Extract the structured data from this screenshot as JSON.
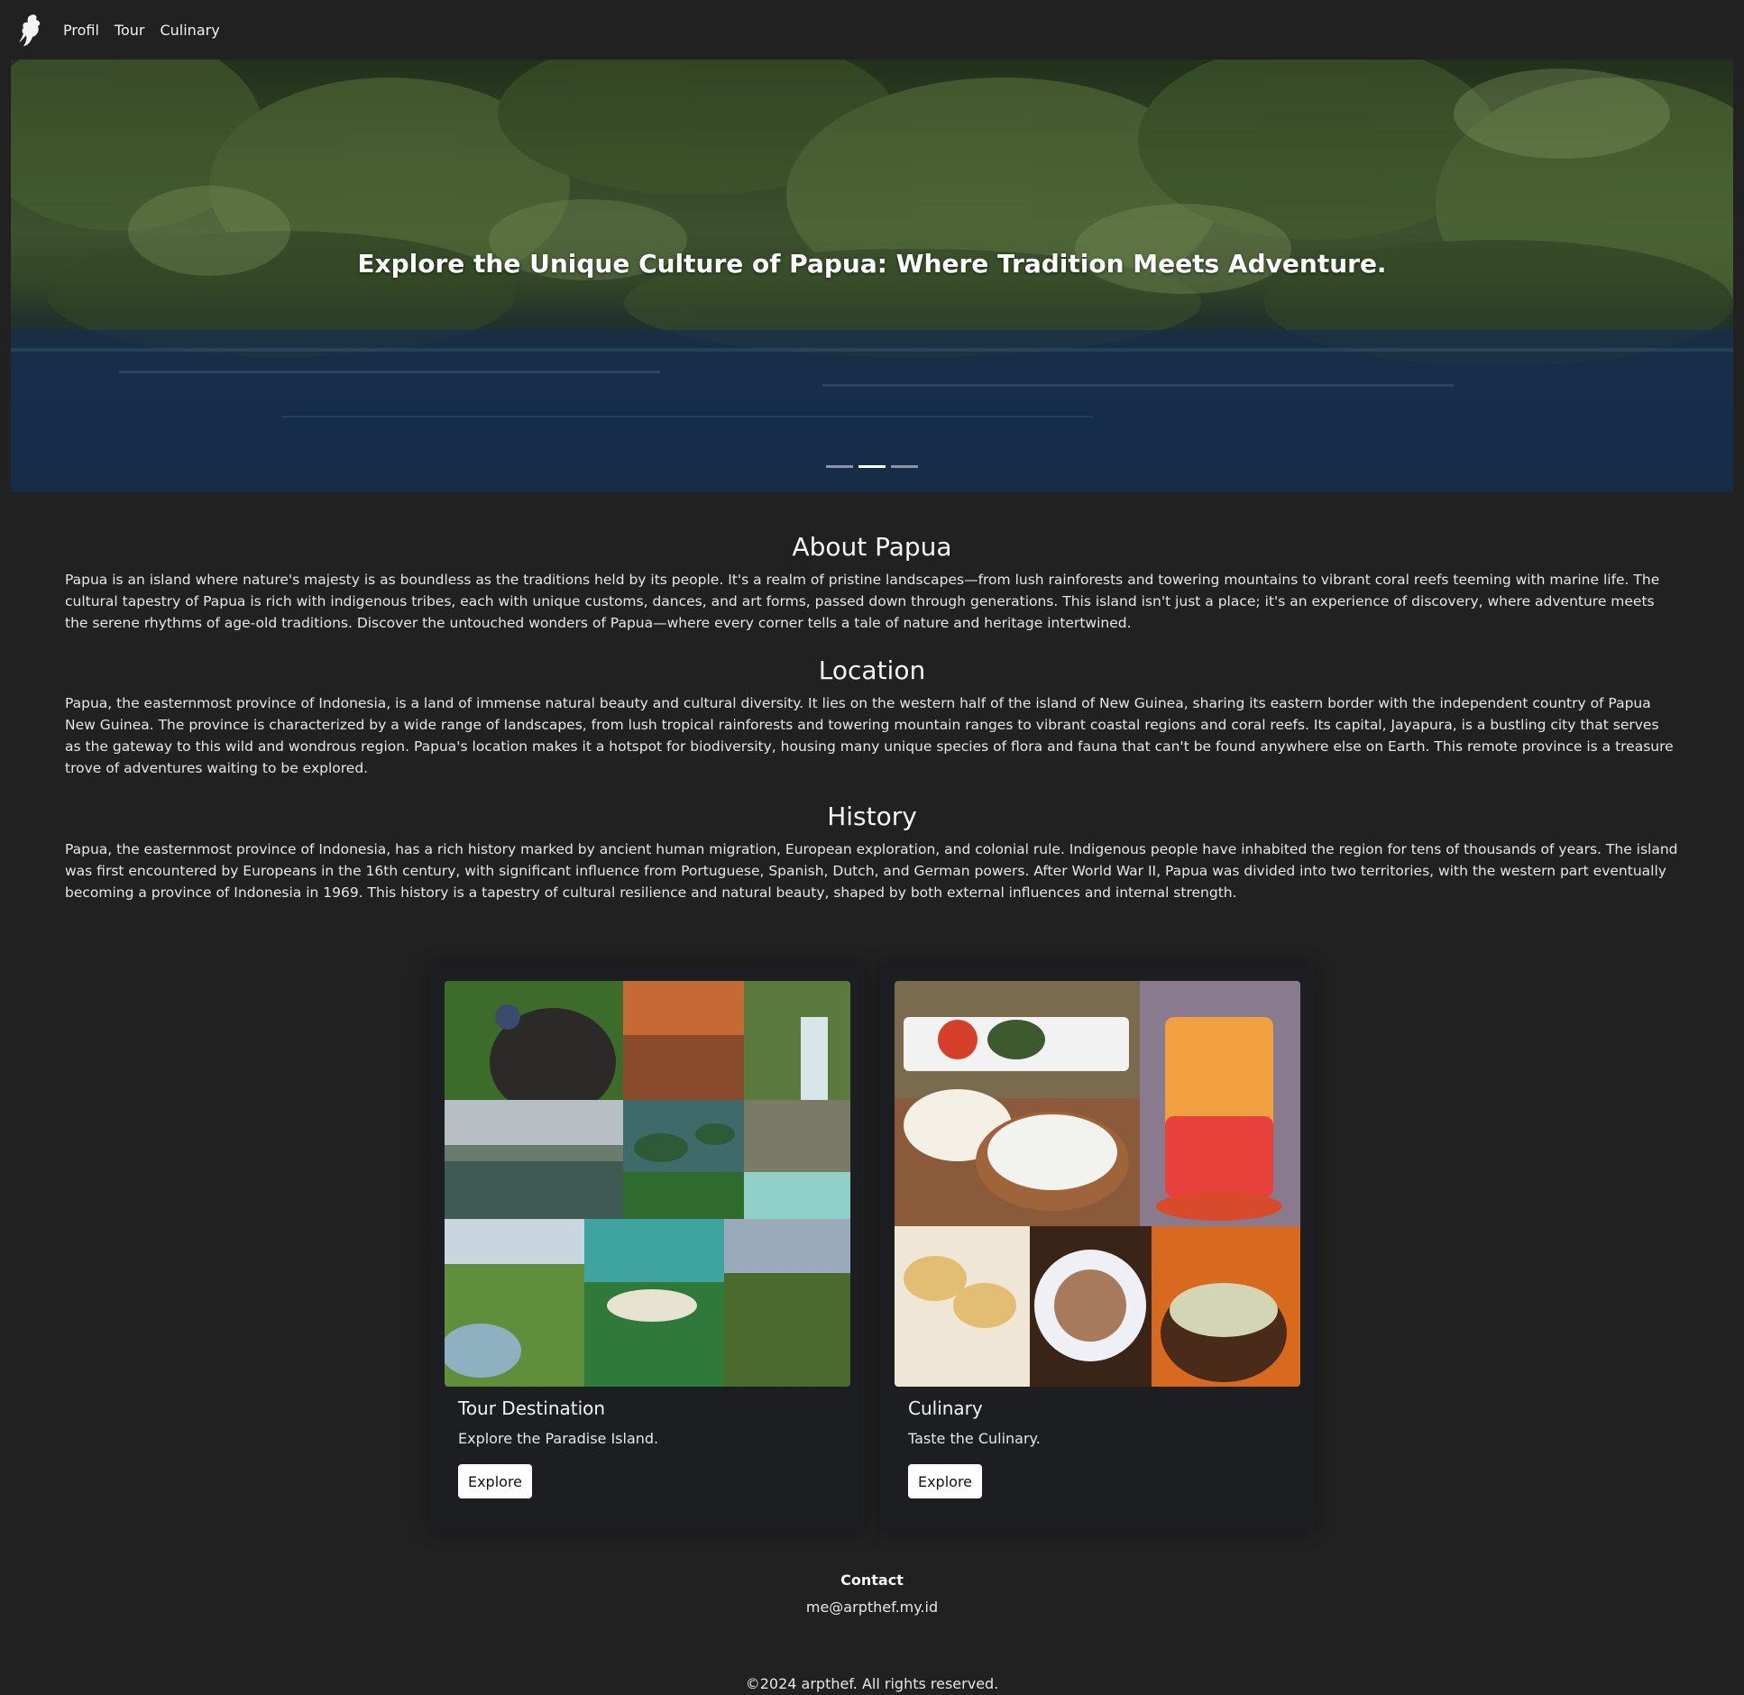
{
  "nav": {
    "logo_icon": "bird-of-paradise-logo-icon",
    "links": [
      "Profil",
      "Tour",
      "Culinary"
    ]
  },
  "hero": {
    "title": "Explore the Unique Culture of Papua: Where Tradition Meets Adventure.",
    "slide_count": 3,
    "active_slide": 2
  },
  "sections": {
    "about": {
      "heading": "About Papua",
      "body": "Papua is an island where nature's majesty is as boundless as the traditions held by its people. It's a realm of pristine landscapes—from lush rainforests and towering mountains to vibrant coral reefs teeming with marine life. The cultural tapestry of Papua is rich with indigenous tribes, each with unique customs, dances, and art forms, passed down through generations. This island isn't just a place; it's an experience of discovery, where adventure meets the serene rhythms of age-old traditions. Discover the untouched wonders of Papua—where every corner tells a tale of nature and heritage intertwined."
    },
    "location": {
      "heading": "Location",
      "body": "Papua, the easternmost province of Indonesia, is a land of immense natural beauty and cultural diversity. It lies on the western half of the island of New Guinea, sharing its eastern border with the independent country of Papua New Guinea. The province is characterized by a wide range of landscapes, from lush tropical rainforests and towering mountain ranges to vibrant coastal regions and coral reefs. Its capital, Jayapura, is a bustling city that serves as the gateway to this wild and wondrous region. Papua's location makes it a hotspot for biodiversity, housing many unique species of flora and fauna that can't be found anywhere else on Earth. This remote province is a treasure trove of adventures waiting to be explored."
    },
    "history": {
      "heading": "History",
      "body": "Papua, the easternmost province of Indonesia, has a rich history marked by ancient human migration, European exploration, and colonial rule. Indigenous people have inhabited the region for tens of thousands of years. The island was first encountered by Europeans in the 16th century, with significant influence from Portuguese, Spanish, Dutch, and German powers. After World War II, Papua was divided into two territories, with the western part eventually becoming a province of Indonesia in 1969. This history is a tapestry of cultural resilience and natural beauty, shaped by both external influences and internal strength."
    }
  },
  "cards": [
    {
      "title": "Tour Destination",
      "text": "Explore the Paradise Island.",
      "button": "Explore"
    },
    {
      "title": "Culinary",
      "text": "Taste the Culinary.",
      "button": "Explore"
    }
  ],
  "footer": {
    "contact_title": "Contact",
    "email": "me@arpthef.my.id",
    "copyright": "©2024 arpthef. All rights reserved."
  }
}
